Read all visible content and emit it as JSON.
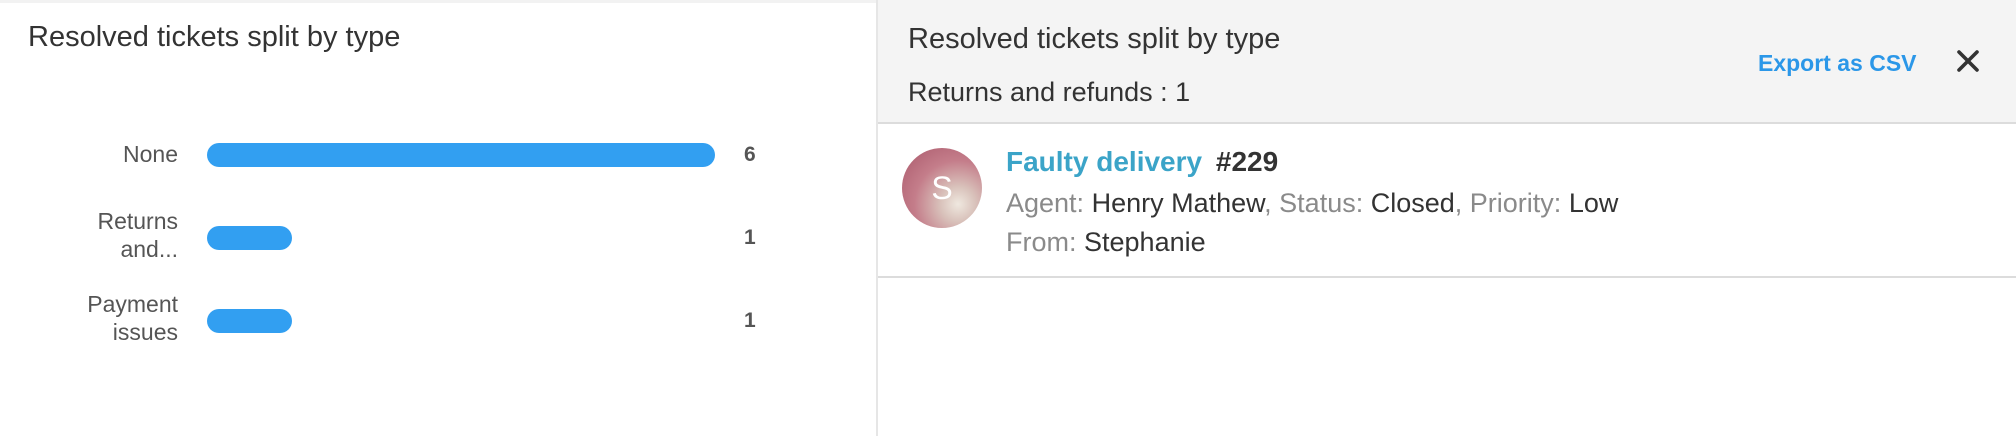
{
  "left": {
    "title": "Resolved tickets split by type"
  },
  "chart_data": {
    "type": "bar",
    "orientation": "horizontal",
    "title": "Resolved tickets split by type",
    "categories": [
      "None",
      "Returns and...",
      "Payment issues"
    ],
    "category_lines": [
      [
        "None"
      ],
      [
        "Returns",
        "and..."
      ],
      [
        "Payment",
        "issues"
      ]
    ],
    "values": [
      6,
      1,
      1
    ],
    "xlim": [
      0,
      6
    ],
    "bar_color": "#329ff1",
    "grid": false,
    "legend": "none"
  },
  "right": {
    "title": "Resolved tickets split by type",
    "subtitle": "Returns and refunds : 1",
    "export_label": "Export as CSV",
    "close_label": "close-icon",
    "accent": "#2b97e8"
  },
  "ticket": {
    "avatar_letter": "S",
    "subject": "Faulty delivery",
    "subject_color": "#3ba4c8",
    "number": "#229",
    "agent_key": "Agent:",
    "agent_value": "Henry Mathew",
    "status_key": "Status:",
    "status_value": "Closed",
    "priority_key": "Priority:",
    "priority_value": "Low",
    "from_key": "From:",
    "from_value": "Stephanie",
    "separator": ", "
  }
}
